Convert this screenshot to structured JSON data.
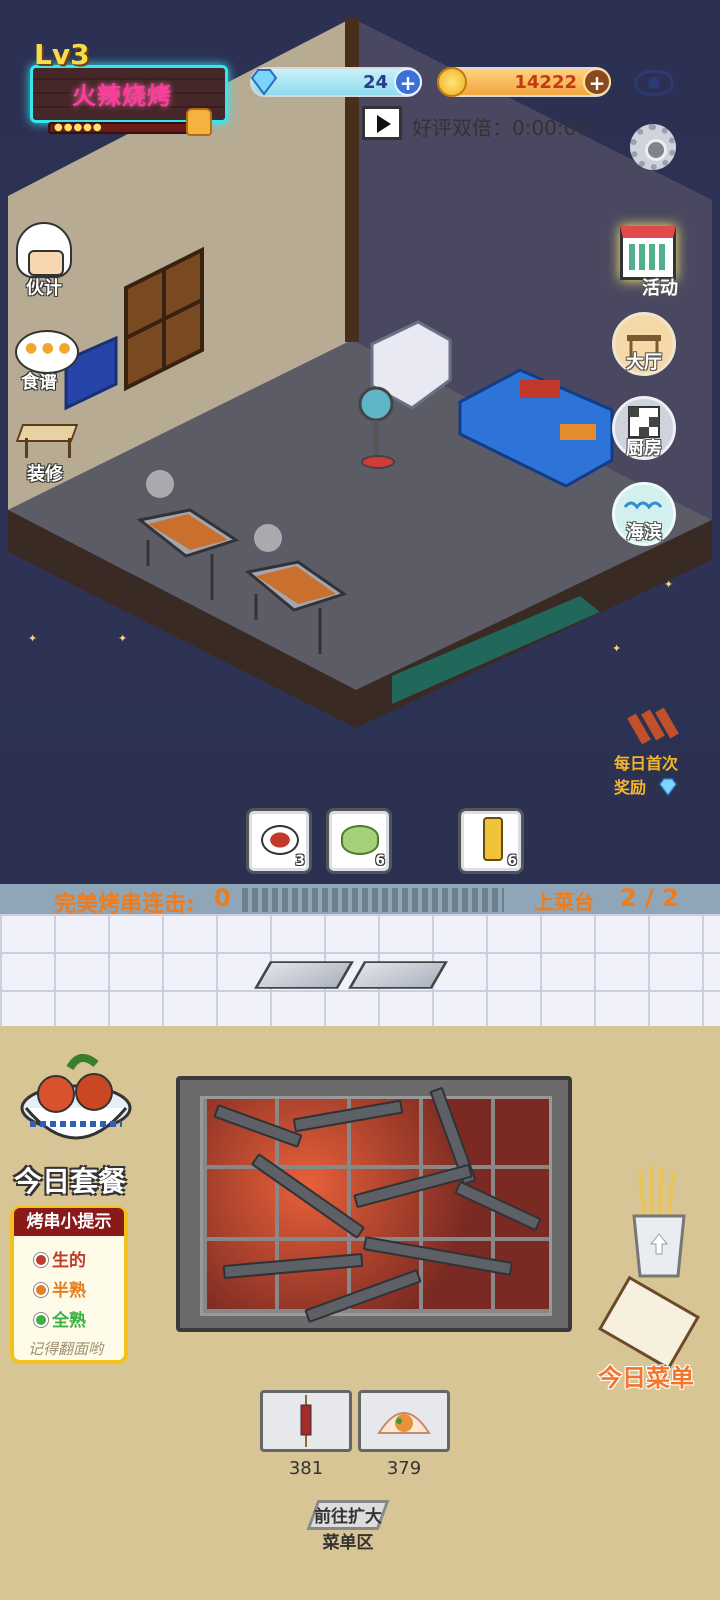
{
  "header": {
    "level": "Lv3",
    "shop_name": "火辣烧烤",
    "gems": "24",
    "gold": "14222",
    "double_reward_text": "好评双倍：0:00:00"
  },
  "left_menu": {
    "staff_label": "伙计",
    "recipe_label": "食谱",
    "decor_label": "装修"
  },
  "right_menu": {
    "activity_label": "活动",
    "hall_label": "大厅",
    "kitchen_label": "厨房",
    "beach_label": "海滨",
    "daily_reward_line1": "每日首次",
    "daily_reward_line2": "奖励"
  },
  "ingredients": [
    {
      "name": "sauce",
      "count": "3"
    },
    {
      "name": "cucumber",
      "count": "6"
    },
    {
      "name": "beer",
      "count": "6"
    }
  ],
  "counter": {
    "combo_label": "完美烤串连击:",
    "combo_value": "0",
    "serve_label": "上菜台",
    "serve_value": "2 / 2"
  },
  "kitchen": {
    "set_meal_label": "今日套餐",
    "tips_title": "烤串小提示",
    "tip_raw": "生的",
    "tip_medium": "半熟",
    "tip_done": "全熟",
    "tips_footer": "记得翻面哟",
    "today_menu_label": "今日菜单",
    "menu_items": [
      {
        "name": "skewer",
        "count": "381"
      },
      {
        "name": "scallop",
        "count": "379"
      }
    ],
    "expand_line1": "前往扩大",
    "expand_line2": "菜单区"
  },
  "colors": {
    "accent_orange": "#f07b1b",
    "neon_cyan": "#33e6f0",
    "neon_pink": "#ff3c9a",
    "tip_raw": "#c0392b",
    "tip_medium": "#e67e22",
    "tip_done": "#3cb043"
  }
}
